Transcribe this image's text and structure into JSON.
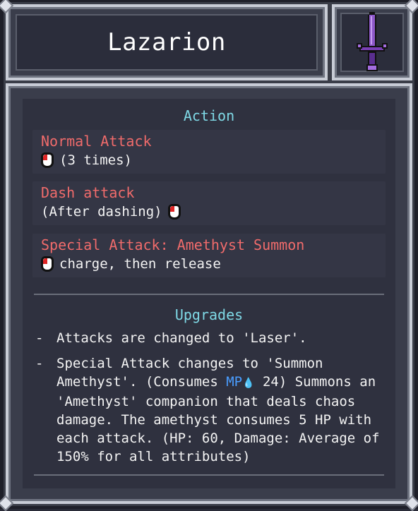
{
  "title": "Lazarion",
  "weapon_icon": "amethyst-sword-icon",
  "action": {
    "heading": "Action",
    "items": [
      {
        "title": "Normal Attack",
        "body": "(3 times)"
      },
      {
        "title": "Dash attack",
        "body": "(After dashing)"
      },
      {
        "title": "Special Attack: Amethyst Summon",
        "body": "charge, then release"
      }
    ]
  },
  "upgrades": {
    "heading": "Upgrades",
    "bullet": "-",
    "item1": "Attacks are changed to 'Laser'.",
    "item2_pre": "Special Attack changes to 'Summon Amethyst'. (Consumes ",
    "mp_label": "MP",
    "item2_post": " 24) Summons an 'Amethyst' companion that deals chaos damage. The amethyst consumes 5 HP with each attack. (HP: 60, Damage: Average of 150% for all attributes)"
  },
  "colors": {
    "action_title": "#f06b6b",
    "section_heading": "#7fd9e6",
    "mp": "#4a9dff"
  }
}
